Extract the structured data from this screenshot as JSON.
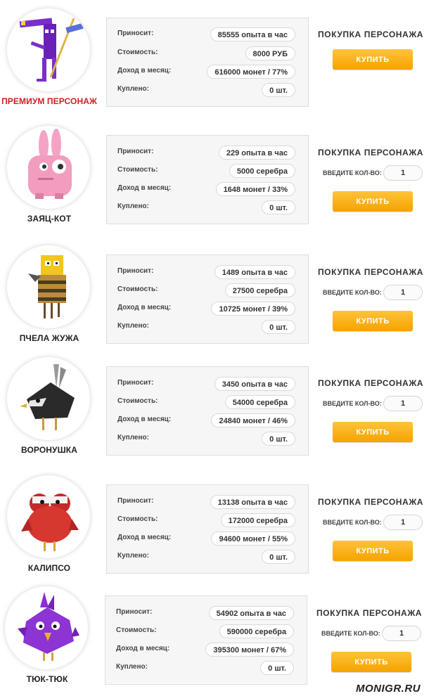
{
  "characters": [
    {
      "name": "ПРЕМИУМ ПЕРСОНАЖ",
      "brings_label": "Приносит:",
      "brings": "85555 опыта в час",
      "cost_label": "Стоимость:",
      "cost": "8000 РУБ",
      "income_label": "Доход в месяц:",
      "income": "616000 монет / 77%",
      "bought_label": "Куплено:",
      "bought": "0 шт.",
      "purchase_title": "ПОКУПКА ПЕРСОНАЖА",
      "buy_label": "КУПИТЬ",
      "icon": "premium-purple-creature-icon"
    },
    {
      "name": "ЗАЯЦ-КОТ",
      "brings_label": "Приносит:",
      "brings": "229 опыта в час",
      "cost_label": "Стоимость:",
      "cost": "5000 серебра",
      "income_label": "Доход в месяц:",
      "income": "1648 монет / 33%",
      "bought_label": "Куплено:",
      "bought": "0 шт.",
      "purchase_title": "ПОКУПКА ПЕРСОНАЖА",
      "qty_label": "ВВЕДИТЕ КОЛ-ВО:",
      "qty_value": "1",
      "buy_label": "КУПИТЬ",
      "icon": "hare-cat-icon"
    },
    {
      "name": "ПЧЕЛА ЖУЖА",
      "brings_label": "Приносит:",
      "brings": "1489 опыта в час",
      "cost_label": "Стоимость:",
      "cost": "27500 серебра",
      "income_label": "Доход в месяц:",
      "income": "10725 монет / 39%",
      "bought_label": "Куплено:",
      "bought": "0 шт.",
      "purchase_title": "ПОКУПКА ПЕРСОНАЖА",
      "qty_label": "ВВЕДИТЕ КОЛ-ВО:",
      "qty_value": "1",
      "buy_label": "КУПИТЬ",
      "icon": "bee-icon"
    },
    {
      "name": "ВОРОНУШКА",
      "brings_label": "Приносит:",
      "brings": "3450 опыта в час",
      "cost_label": "Стоимость:",
      "cost": "54000 серебра",
      "income_label": "Доход в месяц:",
      "income": "24840 монет / 46%",
      "bought_label": "Куплено:",
      "bought": "0 шт.",
      "purchase_title": "ПОКУПКА ПЕРСОНАЖА",
      "qty_label": "ВВЕДИТЕ КОЛ-ВО:",
      "qty_value": "1",
      "buy_label": "КУПИТЬ",
      "icon": "crow-icon"
    },
    {
      "name": "КАЛИПСО",
      "brings_label": "Приносит:",
      "brings": "13138 опыта в час",
      "cost_label": "Стоимость:",
      "cost": "172000 серебра",
      "income_label": "Доход в месяц:",
      "income": "94600 монет / 55%",
      "bought_label": "Куплено:",
      "bought": "0 шт.",
      "purchase_title": "ПОКУПКА ПЕРСОНАЖА",
      "qty_label": "ВВЕДИТЕ КОЛ-ВО:",
      "qty_value": "1",
      "buy_label": "КУПИТЬ",
      "icon": "red-bird-icon"
    },
    {
      "name": "ТЮК-ТЮК",
      "brings_label": "Приносит:",
      "brings": "54902 опыта в час",
      "cost_label": "Стоимость:",
      "cost": "590000 серебра",
      "income_label": "Доход в месяц:",
      "income": "395300 монет / 67%",
      "bought_label": "Куплено:",
      "bought": "0 шт.",
      "purchase_title": "ПОКУПКА ПЕРСОНАЖА",
      "qty_label": "ВВЕДИТЕ КОЛ-ВО:",
      "qty_value": "1",
      "buy_label": "КУПИТЬ",
      "icon": "purple-spiky-bird-icon"
    }
  ],
  "watermark": "MONIGR.RU",
  "colors": {
    "accent_button": "#f7a800",
    "premium_name": "#d21e1e",
    "panel_bg": "#f6f6f6"
  }
}
